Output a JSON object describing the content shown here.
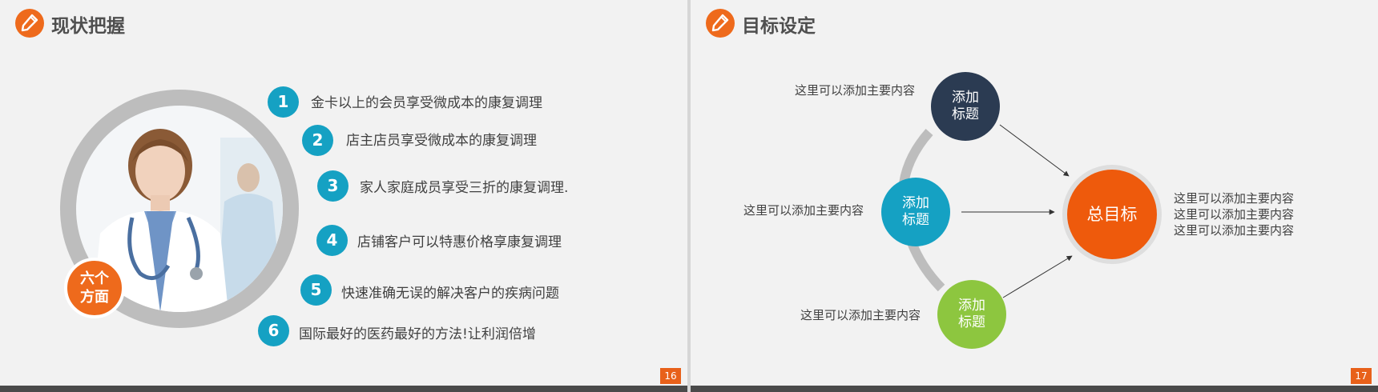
{
  "left_slide": {
    "title": "现状把握",
    "badge_lines": [
      "六个",
      "方面"
    ],
    "items": [
      {
        "num": "1",
        "text": "金卡以上的会员享受微成本的康复调理"
      },
      {
        "num": "2",
        "text": "店主店员享受微成本的康复调理"
      },
      {
        "num": "3",
        "text": "家人家庭成员享受三折的康复调理."
      },
      {
        "num": "4",
        "text": "店铺客户可以特惠价格享康复调理"
      },
      {
        "num": "5",
        "text": "快速准确无误的解决客户的疾病问题"
      },
      {
        "num": "6",
        "text": "国际最好的医药最好的方法!让利润倍增"
      }
    ],
    "page_number": "16"
  },
  "right_slide": {
    "title": "目标设定",
    "nodes": [
      {
        "lines": [
          "添加",
          "标题"
        ],
        "color": "#2b3b52",
        "note": "这里可以添加主要内容"
      },
      {
        "lines": [
          "添加",
          "标题"
        ],
        "color": "#15a1c3",
        "note": "这里可以添加主要内容"
      },
      {
        "lines": [
          "添加",
          "标题"
        ],
        "color": "#8dc63f",
        "note": "这里可以添加主要内容"
      }
    ],
    "goal_label": "总目标",
    "goal_notes": [
      "这里可以添加主要内容",
      "这里可以添加主要内容",
      "这里可以添加主要内容"
    ],
    "page_number": "17"
  },
  "colors": {
    "accent_orange": "#ee6a1c",
    "item_teal": "#15a1c3",
    "footer_bar": "#4a4a4a"
  },
  "icons": {
    "title_icon": "pencil-icon"
  }
}
